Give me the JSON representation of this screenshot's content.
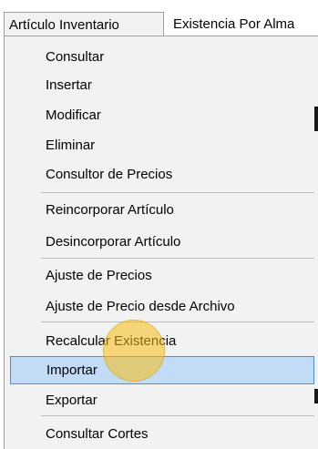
{
  "menubar": {
    "items": [
      {
        "label": "Artículo Inventario"
      },
      {
        "label": "Existencia Por Alma"
      }
    ]
  },
  "menu": {
    "items": [
      {
        "label": "Consultar"
      },
      {
        "label": "Insertar"
      },
      {
        "label": "Modificar"
      },
      {
        "label": "Eliminar"
      },
      {
        "label": "Consultor de Precios"
      },
      {
        "label": "Reincorporar Artículo"
      },
      {
        "label": "Desincorporar Artículo"
      },
      {
        "label": "Ajuste de Precios"
      },
      {
        "label": "Ajuste de Precio desde Archivo"
      },
      {
        "label": "Recalcular Existencia"
      },
      {
        "label": "Importar"
      },
      {
        "label": "Exportar"
      },
      {
        "label": "Consultar Cortes"
      }
    ],
    "highlighted_index": 10
  },
  "colors": {
    "highlight_fill": "#c2dcf7",
    "highlight_border": "#4a90d9",
    "menu_background": "#f2f2f2",
    "cursor_halo": "#f7be14"
  }
}
